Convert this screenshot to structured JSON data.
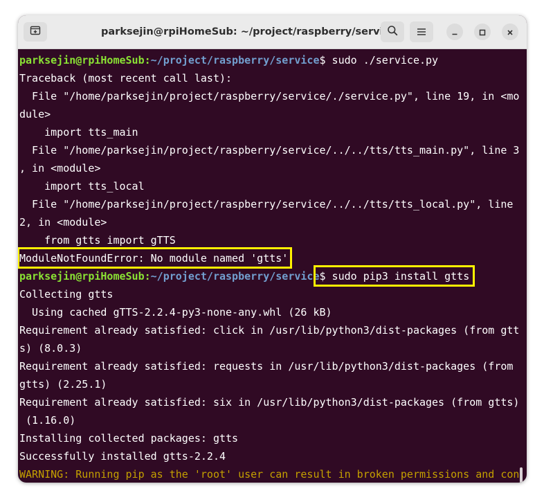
{
  "window": {
    "title": "parksejin@rpiHomeSub: ~/project/raspberry/service"
  },
  "terminal": {
    "prompt_user": "parksejin@rpiHomeSub",
    "prompt_path": "~/project/raspberry/service",
    "lines": {
      "l1_cmd": "$ sudo ./service.py",
      "l2": "Traceback (most recent call last):",
      "l3": "  File \"/home/parksejin/project/raspberry/service/./service.py\", line 19, in <mo",
      "l4": "dule>",
      "l5": "    import tts_main",
      "l6": "  File \"/home/parksejin/project/raspberry/service/../../tts/tts_main.py\", line 3",
      "l7": ", in <module>",
      "l8": "    import tts_local",
      "l9": "  File \"/home/parksejin/project/raspberry/service/../../tts/tts_local.py\", line",
      "l10": "2, in <module>",
      "l11": "    from gtts import gTTS",
      "l12": "ModuleNotFoundError: No module named 'gtts'",
      "l13_cmd": "$ sudo pip3 install gtts",
      "l14": "Collecting gtts",
      "l15": "  Using cached gTTS-2.2.4-py3-none-any.whl (26 kB)",
      "l16": "Requirement already satisfied: click in /usr/lib/python3/dist-packages (from gtt",
      "l17": "s) (8.0.3)",
      "l18": "Requirement already satisfied: requests in /usr/lib/python3/dist-packages (from",
      "l19": "gtts) (2.25.1)",
      "l20": "Requirement already satisfied: six in /usr/lib/python3/dist-packages (from gtts)",
      "l21": " (1.16.0)",
      "l22": "Installing collected packages: gtts",
      "l23": "Successfully installed gtts-2.2.4",
      "l24": "WARNING: Running pip as the 'root' user can result in broken permissions and con"
    }
  },
  "colors": {
    "terminal_bg": "#300a24",
    "prompt_user": "#8ae234",
    "prompt_path": "#729fcf",
    "warning": "#c4a000",
    "highlight": "#fff200"
  },
  "icons": [
    "new-tab-icon",
    "search-icon",
    "hamburger-menu-icon",
    "minimize-icon",
    "maximize-icon",
    "close-icon"
  ]
}
